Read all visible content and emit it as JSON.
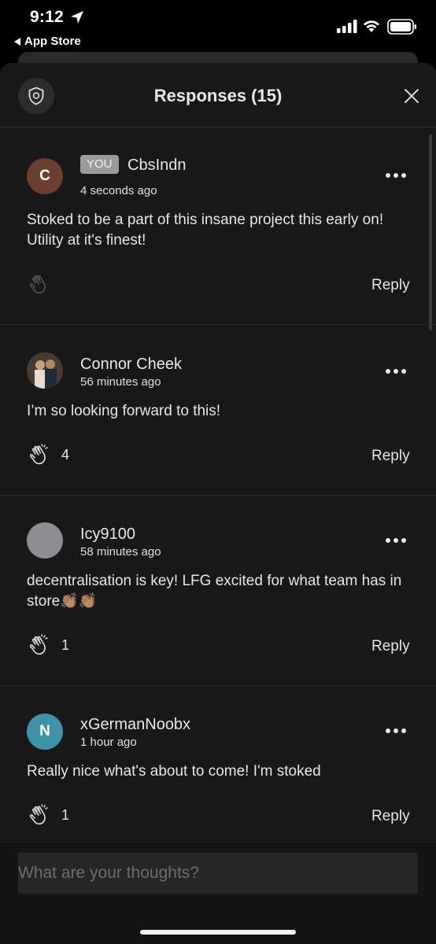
{
  "status_bar": {
    "time": "9:12",
    "back_label": "App Store"
  },
  "header": {
    "title": "Responses (15)"
  },
  "responses": [
    {
      "avatar_initial": "C",
      "avatar_color": "#6b3f2f",
      "you_badge": "YOU",
      "author": "CbsIndn",
      "timestamp": "4 seconds ago",
      "text": "Stoked to be a part of this insane project this early on! Utility at it's finest!",
      "claps": "",
      "reply_label": "Reply"
    },
    {
      "avatar_initial": "",
      "avatar_color": "#5a4a3c",
      "author": "Connor Cheek",
      "timestamp": "56 minutes ago",
      "text": "I’m so looking forward to this!",
      "claps": "4",
      "reply_label": "Reply"
    },
    {
      "avatar_initial": "",
      "avatar_color": "#8d8d93",
      "author": "Icy9100",
      "timestamp": "58 minutes ago",
      "text": "decentralisation is key! LFG excited for what team has in store👏🏽👏🏽",
      "claps": "1",
      "reply_label": "Reply"
    },
    {
      "avatar_initial": "N",
      "avatar_color": "#3e93a8",
      "author": "xGermanNoobx",
      "timestamp": "1 hour ago",
      "text": "Really nice what's about to come! I'm stoked",
      "claps": "1",
      "reply_label": "Reply"
    }
  ],
  "composer": {
    "placeholder": "What are your thoughts?"
  }
}
